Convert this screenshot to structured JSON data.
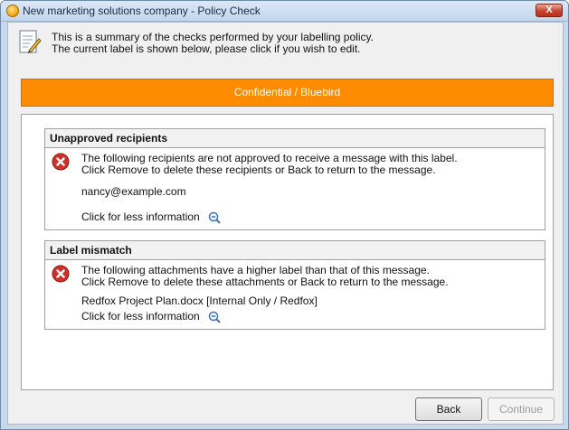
{
  "window": {
    "title": "New marketing solutions company - Policy Check",
    "close_label": "X"
  },
  "summary": {
    "line1": "This is a summary of the checks performed by your labelling policy.",
    "line2": "The current label is shown below, please click if you wish to edit."
  },
  "label": {
    "text": "Confidential / Bluebird",
    "color": "#ff8c00"
  },
  "checks": [
    {
      "title": "Unapproved recipients",
      "line1": "The following recipients are not approved to receive a message with this label.",
      "line2": "Click Remove to delete these recipients or Back to return to the message.",
      "detail": "nancy@example.com",
      "link": "Click for less information"
    },
    {
      "title": "Label mismatch",
      "line1": "The following attachments have a higher label than that of this message.",
      "line2": "Click Remove to delete these attachments or Back to return to the message.",
      "detail": "Redfox Project Plan.docx [Internal Only / Redfox]",
      "link": "Click for less information"
    }
  ],
  "buttons": {
    "back": "Back",
    "continue": "Continue"
  },
  "icons": {
    "app": "app-logo-icon",
    "summary": "document-pencil-icon",
    "error": "error-x-icon",
    "less_info": "zoom-out-icon"
  }
}
